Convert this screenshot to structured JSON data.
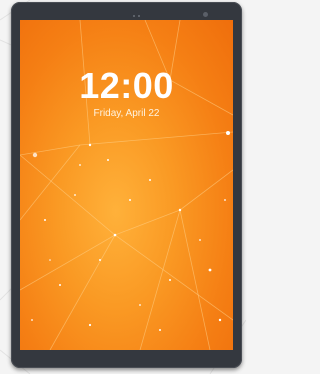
{
  "lockscreen": {
    "time": "12:00",
    "date": "Friday, April 22"
  },
  "colors": {
    "bezel": "#34383f",
    "wallpaper_center": "#ffb13a",
    "wallpaper_edge": "#ef6e0c",
    "text": "#ffffff"
  },
  "icons": [
    "camera-icon"
  ]
}
